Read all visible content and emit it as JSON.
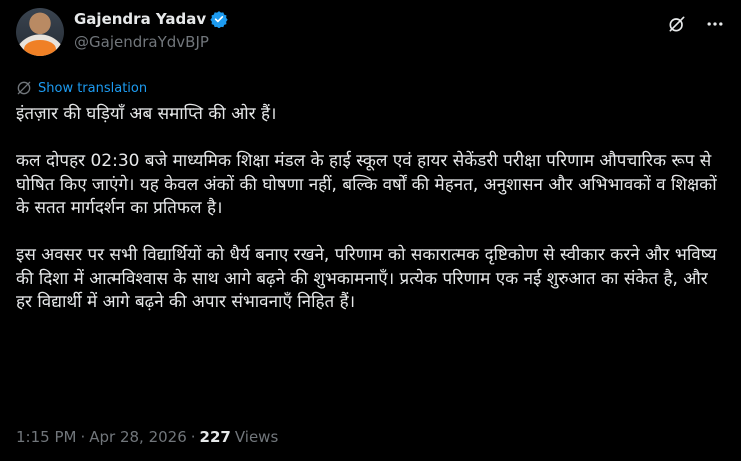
{
  "author": {
    "display_name": "Gajendra Yadav",
    "handle": "@GajendraYdvBJP",
    "verified_color": "#1d9bf0"
  },
  "translate": {
    "label": "Show translation"
  },
  "tweet": {
    "paragraphs": [
      "इंतज़ार की घड़ियाँ अब समाप्ति की ओर हैं।",
      "कल दोपहर 02:30 बजे माध्यमिक शिक्षा मंडल के हाई स्कूल एवं हायर सेकेंडरी परीक्षा परिणाम औपचारिक रूप से घोषित किए जाएंगे। यह केवल अंकों की घोषणा नहीं, बल्कि वर्षों की मेहनत, अनुशासन और अभिभावकों व शिक्षकों के सतत मार्गदर्शन का प्रतिफल है।",
      "इस अवसर पर सभी विद्यार्थियों को धैर्य बनाए रखने, परिणाम को सकारात्मक दृष्टिकोण से स्वीकार करने और भविष्य की दिशा में आत्मविश्वास के साथ आगे बढ़ने की शुभकामनाएँ। प्रत्येक परिणाम एक नई शुरुआत का संकेत है, और हर विद्यार्थी में आगे बढ़ने की अपार संभावनाएँ निहित हैं।"
    ]
  },
  "meta": {
    "time": "1:15 PM",
    "separator1": "·",
    "date": "Apr 28, 2026",
    "separator2": "·",
    "views_count": "227",
    "views_label": "Views"
  },
  "icons": [
    "verified-badge-icon",
    "grok-icon",
    "more-icon",
    "globe-icon"
  ]
}
